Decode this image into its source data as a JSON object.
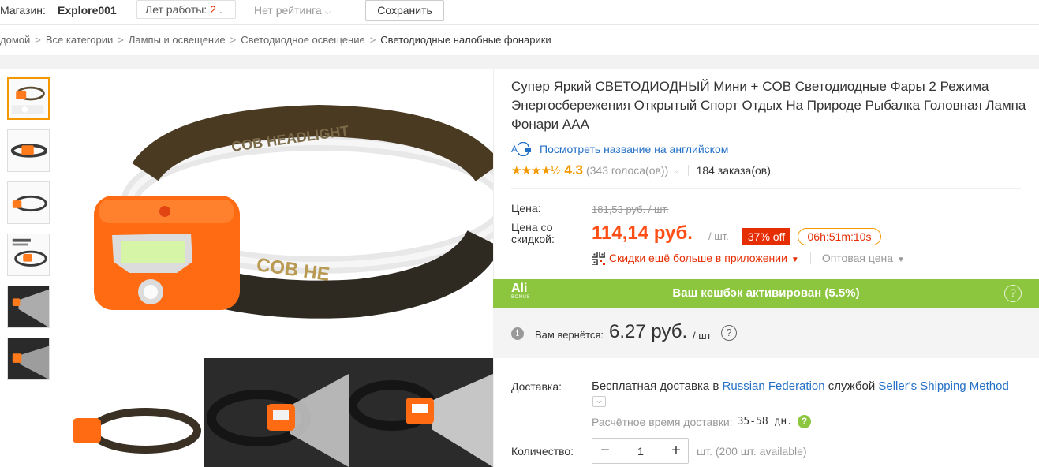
{
  "topbar": {
    "store_label": "Магазин:",
    "store_name": "Explore001",
    "years_label": "Лет работы: ",
    "years_value": "2",
    "years_suffix": " .",
    "rating_label": "Нет рейтинга",
    "save_label": "Сохранить"
  },
  "breadcrumb": {
    "items": [
      "домой",
      "Все категории",
      "Лампы и освещение",
      "Светодиодное освещение",
      "Светодиодные налобные фонарики"
    ],
    "separator": ">"
  },
  "product": {
    "title": "Супер Яркий СВЕТОДИОДНЫЙ Мини + COB Светодиодные Фары 2 Режима Энергосбережения Открытый Спорт Отдых На Природе Рыбалка Головная Лампа Фонари AAA",
    "translate_label": "Посмотреть название на английском",
    "stars": "★★★★½",
    "rating": "4.3",
    "votes": "(343 голоса(ов))",
    "orders": "184 заказа(ов)"
  },
  "pricing": {
    "price_label": "Цена:",
    "old_price": "181,53 руб. / шт.",
    "discount_label": "Цена со скидкой:",
    "new_price": "114,14 руб.",
    "per_unit": "/ шт.",
    "discount_badge": "37% off",
    "timer": "06h:51m:10s",
    "app_discount": "Скидки ещё больше в приложении",
    "wholesale": "Оптовая цена"
  },
  "cashback": {
    "logo_main": "Ali",
    "logo_sub": "BONUS",
    "text": "Ваш кешбэк активирован (5.5%)",
    "help": "?",
    "refund_label": "Вам вернётся:",
    "refund_amount": "6.27 руб.",
    "refund_unit": "/ шт",
    "refund_help": "?"
  },
  "shipping": {
    "label": "Доставка:",
    "prefix": "Бесплатная доставка в ",
    "country": "Russian Federation",
    "middle": " службой ",
    "method": "Seller's Shipping Method",
    "eta_label": "Расчётное время доставки:",
    "eta_days": "35-58 дн.",
    "eta_help": "?"
  },
  "quantity": {
    "label": "Количество:",
    "minus": "−",
    "value": "1",
    "plus": "+",
    "available": "шт. (200 шт. available)"
  },
  "colors": {
    "accent_orange": "#ff4f17",
    "badge_red": "#e62e04",
    "cashback_green": "#8cc63e",
    "link_blue": "#2470c6",
    "star_orange": "#f39800"
  },
  "images": {
    "thumb_count": 6,
    "active_thumb": 0
  }
}
